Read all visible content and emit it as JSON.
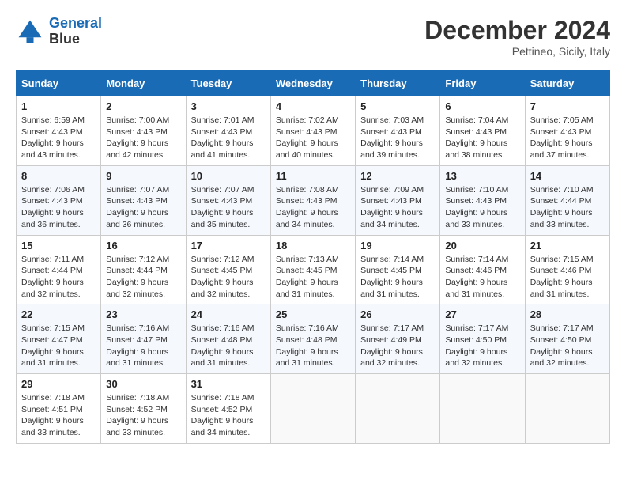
{
  "header": {
    "logo_line1": "General",
    "logo_line2": "Blue",
    "month": "December 2024",
    "location": "Pettineo, Sicily, Italy"
  },
  "columns": [
    "Sunday",
    "Monday",
    "Tuesday",
    "Wednesday",
    "Thursday",
    "Friday",
    "Saturday"
  ],
  "weeks": [
    [
      {
        "day": "1",
        "sunrise": "6:59 AM",
        "sunset": "4:43 PM",
        "daylight": "9 hours and 43 minutes."
      },
      {
        "day": "2",
        "sunrise": "7:00 AM",
        "sunset": "4:43 PM",
        "daylight": "9 hours and 42 minutes."
      },
      {
        "day": "3",
        "sunrise": "7:01 AM",
        "sunset": "4:43 PM",
        "daylight": "9 hours and 41 minutes."
      },
      {
        "day": "4",
        "sunrise": "7:02 AM",
        "sunset": "4:43 PM",
        "daylight": "9 hours and 40 minutes."
      },
      {
        "day": "5",
        "sunrise": "7:03 AM",
        "sunset": "4:43 PM",
        "daylight": "9 hours and 39 minutes."
      },
      {
        "day": "6",
        "sunrise": "7:04 AM",
        "sunset": "4:43 PM",
        "daylight": "9 hours and 38 minutes."
      },
      {
        "day": "7",
        "sunrise": "7:05 AM",
        "sunset": "4:43 PM",
        "daylight": "9 hours and 37 minutes."
      }
    ],
    [
      {
        "day": "8",
        "sunrise": "7:06 AM",
        "sunset": "4:43 PM",
        "daylight": "9 hours and 36 minutes."
      },
      {
        "day": "9",
        "sunrise": "7:07 AM",
        "sunset": "4:43 PM",
        "daylight": "9 hours and 36 minutes."
      },
      {
        "day": "10",
        "sunrise": "7:07 AM",
        "sunset": "4:43 PM",
        "daylight": "9 hours and 35 minutes."
      },
      {
        "day": "11",
        "sunrise": "7:08 AM",
        "sunset": "4:43 PM",
        "daylight": "9 hours and 34 minutes."
      },
      {
        "day": "12",
        "sunrise": "7:09 AM",
        "sunset": "4:43 PM",
        "daylight": "9 hours and 34 minutes."
      },
      {
        "day": "13",
        "sunrise": "7:10 AM",
        "sunset": "4:43 PM",
        "daylight": "9 hours and 33 minutes."
      },
      {
        "day": "14",
        "sunrise": "7:10 AM",
        "sunset": "4:44 PM",
        "daylight": "9 hours and 33 minutes."
      }
    ],
    [
      {
        "day": "15",
        "sunrise": "7:11 AM",
        "sunset": "4:44 PM",
        "daylight": "9 hours and 32 minutes."
      },
      {
        "day": "16",
        "sunrise": "7:12 AM",
        "sunset": "4:44 PM",
        "daylight": "9 hours and 32 minutes."
      },
      {
        "day": "17",
        "sunrise": "7:12 AM",
        "sunset": "4:45 PM",
        "daylight": "9 hours and 32 minutes."
      },
      {
        "day": "18",
        "sunrise": "7:13 AM",
        "sunset": "4:45 PM",
        "daylight": "9 hours and 31 minutes."
      },
      {
        "day": "19",
        "sunrise": "7:14 AM",
        "sunset": "4:45 PM",
        "daylight": "9 hours and 31 minutes."
      },
      {
        "day": "20",
        "sunrise": "7:14 AM",
        "sunset": "4:46 PM",
        "daylight": "9 hours and 31 minutes."
      },
      {
        "day": "21",
        "sunrise": "7:15 AM",
        "sunset": "4:46 PM",
        "daylight": "9 hours and 31 minutes."
      }
    ],
    [
      {
        "day": "22",
        "sunrise": "7:15 AM",
        "sunset": "4:47 PM",
        "daylight": "9 hours and 31 minutes."
      },
      {
        "day": "23",
        "sunrise": "7:16 AM",
        "sunset": "4:47 PM",
        "daylight": "9 hours and 31 minutes."
      },
      {
        "day": "24",
        "sunrise": "7:16 AM",
        "sunset": "4:48 PM",
        "daylight": "9 hours and 31 minutes."
      },
      {
        "day": "25",
        "sunrise": "7:16 AM",
        "sunset": "4:48 PM",
        "daylight": "9 hours and 31 minutes."
      },
      {
        "day": "26",
        "sunrise": "7:17 AM",
        "sunset": "4:49 PM",
        "daylight": "9 hours and 32 minutes."
      },
      {
        "day": "27",
        "sunrise": "7:17 AM",
        "sunset": "4:50 PM",
        "daylight": "9 hours and 32 minutes."
      },
      {
        "day": "28",
        "sunrise": "7:17 AM",
        "sunset": "4:50 PM",
        "daylight": "9 hours and 32 minutes."
      }
    ],
    [
      {
        "day": "29",
        "sunrise": "7:18 AM",
        "sunset": "4:51 PM",
        "daylight": "9 hours and 33 minutes."
      },
      {
        "day": "30",
        "sunrise": "7:18 AM",
        "sunset": "4:52 PM",
        "daylight": "9 hours and 33 minutes."
      },
      {
        "day": "31",
        "sunrise": "7:18 AM",
        "sunset": "4:52 PM",
        "daylight": "9 hours and 34 minutes."
      },
      null,
      null,
      null,
      null
    ]
  ]
}
